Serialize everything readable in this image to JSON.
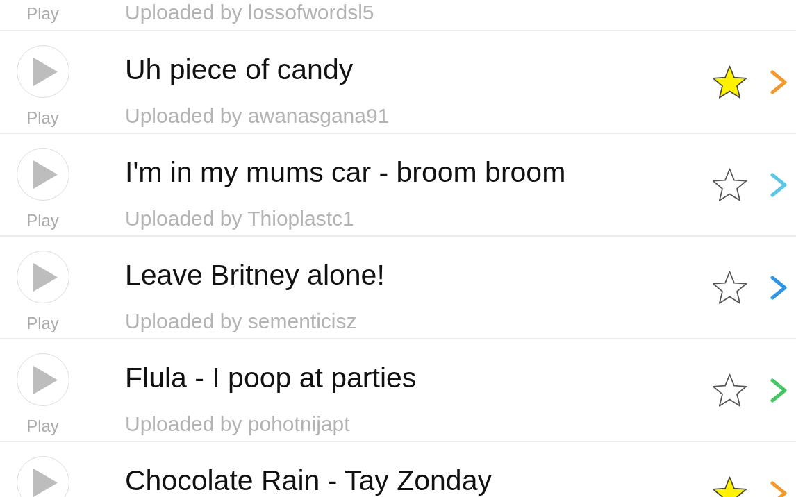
{
  "rows": [
    {
      "kind": "partial",
      "play_label": "Play",
      "uploader": "Uploaded by lossofwordsl5"
    },
    {
      "kind": "full",
      "title": "Uh piece of candy",
      "play_label": "Play",
      "uploader": "Uploaded by awanasgana91",
      "favorite": true,
      "color": "#f39a2e"
    },
    {
      "kind": "full",
      "title": "I'm in my mums car - broom broom",
      "play_label": "Play",
      "uploader": "Uploaded by Thioplastc1",
      "favorite": false,
      "color": "#5cc6e6"
    },
    {
      "kind": "full",
      "title": "Leave Britney alone!",
      "play_label": "Play",
      "uploader": "Uploaded by sementicisz",
      "favorite": false,
      "color": "#2e96e4"
    },
    {
      "kind": "full",
      "title": "Flula - I poop at parties",
      "play_label": "Play",
      "uploader": "Uploaded by pohotnijapt",
      "favorite": false,
      "color": "#43c563"
    },
    {
      "kind": "full",
      "title": "Chocolate Rain - Tay Zonday",
      "favorite": true,
      "color": "#f39a2e"
    }
  ]
}
